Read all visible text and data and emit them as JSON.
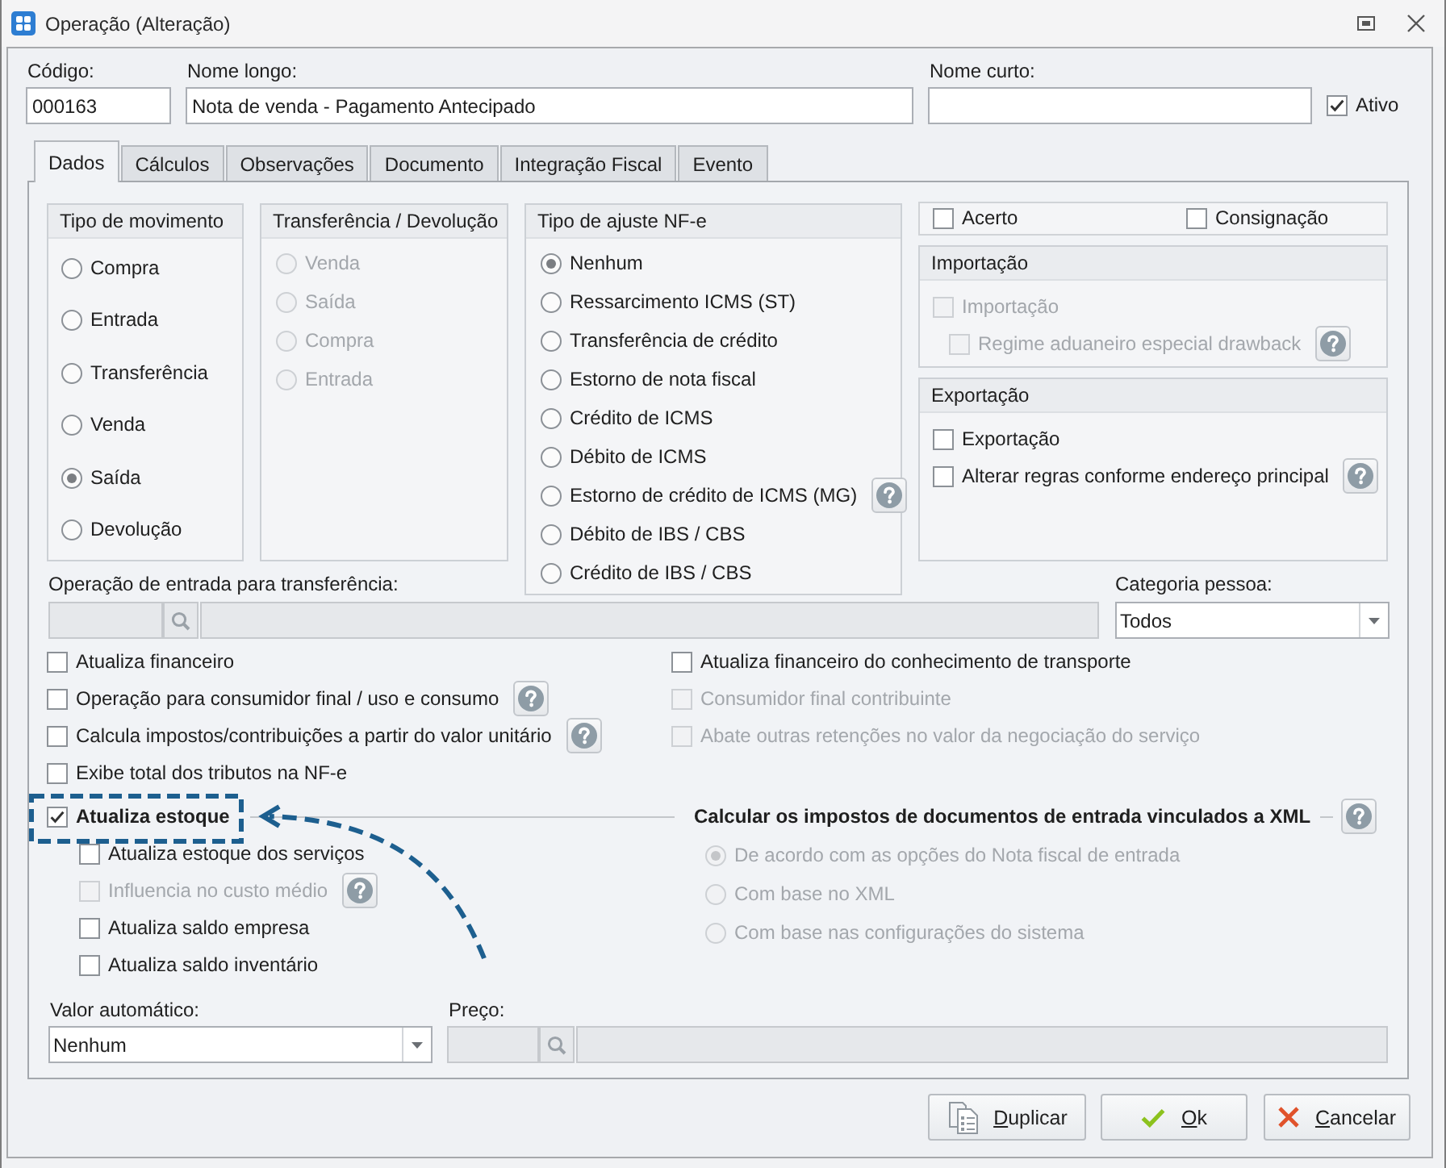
{
  "window": {
    "title": "Operação (Alteração)"
  },
  "header": {
    "codigo": {
      "label": "Código:",
      "value": "000163"
    },
    "nome_longo": {
      "label": "Nome longo:",
      "value": "Nota de venda - Pagamento Antecipado"
    },
    "nome_curto": {
      "label": "Nome curto:"
    },
    "ativo": {
      "label": "Ativo",
      "checked": true
    }
  },
  "tabs": [
    {
      "label": "Dados",
      "selected": true
    },
    {
      "label": "Cálculos",
      "selected": false
    },
    {
      "label": "Observações",
      "selected": false
    },
    {
      "label": "Documento",
      "selected": false
    },
    {
      "label": "Integração Fiscal",
      "selected": false
    },
    {
      "label": "Evento",
      "selected": false
    }
  ],
  "dados": {
    "tipo_movimento": {
      "title": "Tipo de movimento",
      "disabled": false,
      "options": [
        {
          "label": "Compra",
          "selected": false
        },
        {
          "label": "Entrada",
          "selected": false
        },
        {
          "label": "Transferência",
          "selected": false
        },
        {
          "label": "Venda",
          "selected": false
        },
        {
          "label": "Saída",
          "selected": true
        },
        {
          "label": "Devolução",
          "selected": false
        }
      ]
    },
    "transferencia_devolucao": {
      "title": "Transferência / Devolução",
      "disabled": true,
      "options": [
        {
          "label": "Venda",
          "selected": false
        },
        {
          "label": "Saída",
          "selected": false
        },
        {
          "label": "Compra",
          "selected": false
        },
        {
          "label": "Entrada",
          "selected": false
        }
      ]
    },
    "tipo_ajuste_nfe": {
      "title": "Tipo de ajuste NF-e",
      "disabled": false,
      "options": [
        {
          "label": "Nenhum",
          "selected": true
        },
        {
          "label": "Ressarcimento ICMS (ST)",
          "selected": false
        },
        {
          "label": "Transferência de crédito",
          "selected": false
        },
        {
          "label": "Estorno de nota fiscal",
          "selected": false
        },
        {
          "label": "Crédito de ICMS",
          "selected": false
        },
        {
          "label": "Débito de ICMS",
          "selected": false
        },
        {
          "label": "Estorno de crédito de ICMS (MG)",
          "selected": false,
          "help": true
        },
        {
          "label": "Débito de IBS / CBS",
          "selected": false
        },
        {
          "label": "Crédito de IBS / CBS",
          "selected": false
        }
      ]
    },
    "flags": [
      {
        "label": "Acerto",
        "checked": false
      },
      {
        "label": "Consignação",
        "checked": false
      }
    ],
    "importacao": {
      "title": "Importação",
      "options": [
        {
          "label": "Importação",
          "checked": false,
          "disabled": true,
          "children": [
            {
              "label": "Regime aduaneiro especial drawback",
              "checked": false,
              "disabled": true,
              "help": true
            }
          ]
        }
      ]
    },
    "exportacao": {
      "title": "Exportação",
      "options": [
        {
          "label": "Exportação",
          "checked": false,
          "disabled": false
        },
        {
          "label": "Alterar regras conforme endereço principal",
          "checked": false,
          "disabled": false,
          "help": true
        }
      ]
    },
    "operacao_entrada": {
      "label": "Operação de entrada para transferência:",
      "disabled": true
    },
    "categoria_pessoa": {
      "label": "Categoria pessoa:",
      "value": "Todos"
    },
    "opcoes_esquerda": [
      {
        "label": "Atualiza financeiro",
        "checked": false,
        "disabled": false
      },
      {
        "label": "Operação para consumidor final / uso e consumo",
        "checked": false,
        "disabled": false,
        "help": true
      },
      {
        "label": "Calcula impostos/contribuições a partir do valor unitário",
        "checked": false,
        "disabled": false,
        "help": true
      },
      {
        "label": "Exibe total dos tributos na NF-e",
        "checked": false,
        "disabled": false
      }
    ],
    "opcoes_direita": [
      {
        "label": "Atualiza financeiro do conhecimento de transporte",
        "checked": false,
        "disabled": false
      },
      {
        "label": "Consumidor final contribuinte",
        "checked": false,
        "disabled": true
      },
      {
        "label": "Abate outras retenções no valor da negociação do serviço",
        "checked": false,
        "disabled": true
      }
    ],
    "atualiza_estoque": {
      "label": "Atualiza estoque",
      "checked": true,
      "highlighted": true,
      "children": [
        {
          "label": "Atualiza estoque dos serviços",
          "checked": false,
          "disabled": false
        },
        {
          "label": "Influencia no custo médio",
          "checked": false,
          "disabled": true,
          "help": true
        },
        {
          "label": "Atualiza saldo empresa",
          "checked": false,
          "disabled": false
        },
        {
          "label": "Atualiza saldo inventário",
          "checked": false,
          "disabled": false
        }
      ]
    },
    "calculo_xml": {
      "title": "Calcular os impostos de documentos de entrada vinculados a XML",
      "disabled": true,
      "help": true,
      "options": [
        {
          "label": "De acordo com as opções do Nota fiscal de entrada",
          "selected": true
        },
        {
          "label": "Com base no XML",
          "selected": false
        },
        {
          "label": "Com base nas configurações do sistema",
          "selected": false
        }
      ]
    },
    "valor_automatico": {
      "label": "Valor automático:",
      "value": "Nenhum"
    },
    "preco": {
      "label": "Preço:",
      "disabled": true
    }
  },
  "buttons": [
    {
      "kind": "duplicate",
      "label": "Duplicar"
    },
    {
      "kind": "ok",
      "label": "Ok"
    },
    {
      "kind": "cancel",
      "label": "Cancelar"
    }
  ]
}
